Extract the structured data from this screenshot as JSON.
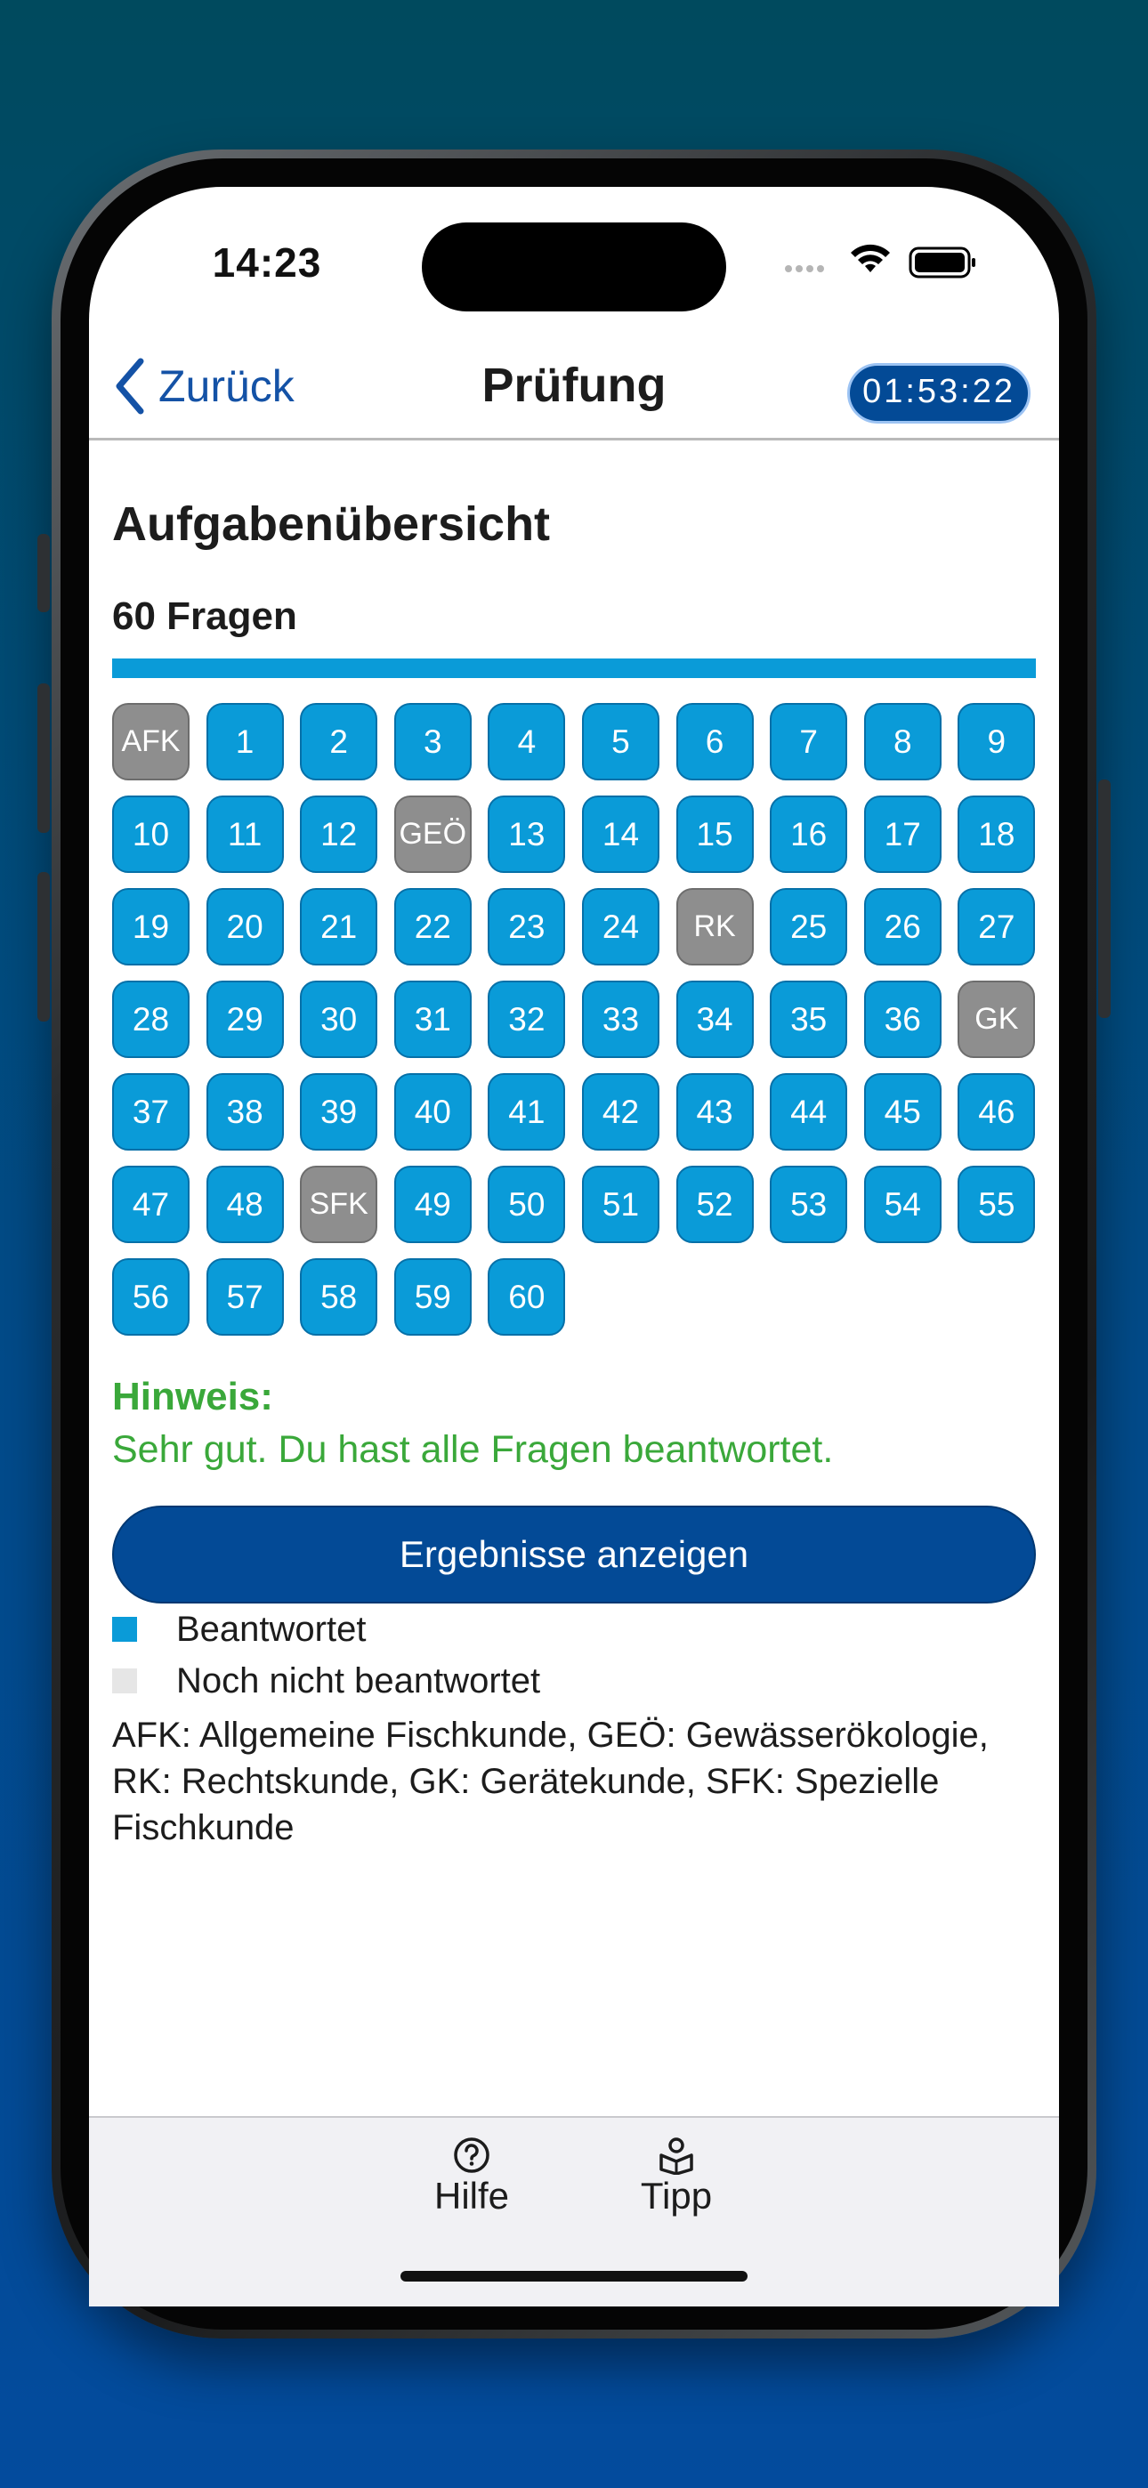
{
  "status": {
    "time": "14:23"
  },
  "nav": {
    "back_label": "Zurück",
    "title": "Prüfung",
    "timer": "01:53:22"
  },
  "overview": {
    "heading": "Aufgabenübersicht",
    "count": "60 Fragen",
    "progress": 1.0,
    "rows": [
      [
        "AFK",
        "1",
        "2",
        "3",
        "4",
        "5",
        "6",
        "7",
        "8",
        "9"
      ],
      [
        "10",
        "11",
        "12",
        "GEÖ",
        "13",
        "14",
        "15",
        "16",
        "17",
        "18"
      ],
      [
        "19",
        "20",
        "21",
        "22",
        "23",
        "24",
        "RK",
        "25",
        "26",
        "27"
      ],
      [
        "28",
        "29",
        "30",
        "31",
        "32",
        "33",
        "34",
        "35",
        "36",
        "GK"
      ],
      [
        "37",
        "38",
        "39",
        "40",
        "41",
        "42",
        "43",
        "44",
        "45",
        "46"
      ],
      [
        "47",
        "48",
        "SFK",
        "49",
        "50",
        "51",
        "52",
        "53",
        "54",
        "55"
      ],
      [
        "56",
        "57",
        "58",
        "59",
        "60"
      ]
    ],
    "categories": [
      "AFK",
      "GEÖ",
      "RK",
      "GK",
      "SFK"
    ]
  },
  "hint": {
    "title": "Hinweis:",
    "text": "Sehr gut. Du hast alle Fragen beantwortet."
  },
  "result_button": "Ergebnisse anzeigen",
  "legend": {
    "answered": "Beantwortet",
    "unanswered": "Noch nicht beantwortet",
    "abbreviations": "AFK: Allgemeine Fischkunde, GEÖ: Gewässerökologie, RK: Rechtskunde, GK: Gerätekunde, SFK: Spezielle Fischkunde"
  },
  "tabs": {
    "help": "Hilfe",
    "tip": "Tipp"
  },
  "colors": {
    "answered": "#0a9bd8",
    "unanswered": "#e6e6e6",
    "category": "#8e8e8e",
    "accent": "#034a96",
    "hint": "#3aa83a"
  }
}
